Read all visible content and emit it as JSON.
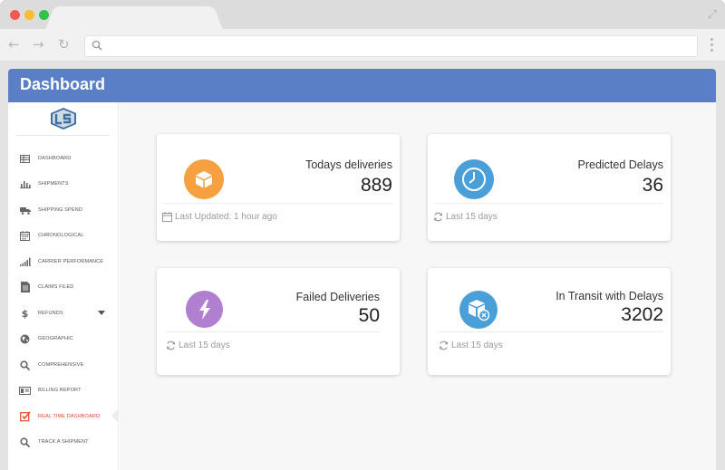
{
  "colors": {
    "header": "#5b7fc7",
    "orange": "#f6a042",
    "blue": "#4a9fd8",
    "purple": "#b07fd0",
    "active_nav": "#e44a2a"
  },
  "header": {
    "title": "Dashboard"
  },
  "sidebar": {
    "logo_icon": "ls-logo-icon",
    "items": [
      {
        "label": "DASHBOARD",
        "icon": "table-icon"
      },
      {
        "label": "SHIPMENTS",
        "icon": "bar-chart-icon"
      },
      {
        "label": "SHIPPING SPEND",
        "icon": "truck-icon"
      },
      {
        "label": "CHRONOLOGICAL",
        "icon": "calendar-icon"
      },
      {
        "label": "CARRIER PERFORMANCE",
        "icon": "signal-bars-icon"
      },
      {
        "label": "CLAIMS FILED",
        "icon": "document-icon"
      },
      {
        "label": "REFUNDS",
        "icon": "dollar-icon"
      },
      {
        "label": "GEOGRAPHIC",
        "icon": "globe-icon"
      },
      {
        "label": "COMPREHENSIVE",
        "icon": "search-icon"
      },
      {
        "label": "BILLING REPORT",
        "icon": "billing-icon"
      },
      {
        "label_a": "REAL TIME",
        "label_b": "DASHBOARD",
        "icon": "checkbox-icon"
      },
      {
        "label": "TRACK A SHIPMENT",
        "icon": "search-icon"
      }
    ]
  },
  "cards": [
    {
      "title": "Todays deliveries",
      "value": "889",
      "footer": "Last Updated: 1 hour ago",
      "icon": "box-icon",
      "footer_icon": "calendar-icon"
    },
    {
      "title": "Predicted Delays",
      "value": "36",
      "footer": "Last 15 days",
      "icon": "clock-icon",
      "footer_icon": "refresh-icon"
    },
    {
      "title": "Failed Deliveries",
      "value": "50",
      "footer": "Last 15 days",
      "icon": "lightning-icon",
      "footer_icon": "refresh-icon"
    },
    {
      "title": "In Transit with Delays",
      "value": "3202",
      "footer": "Last 15 days",
      "icon": "package-delay-icon",
      "footer_icon": "refresh-icon"
    }
  ]
}
